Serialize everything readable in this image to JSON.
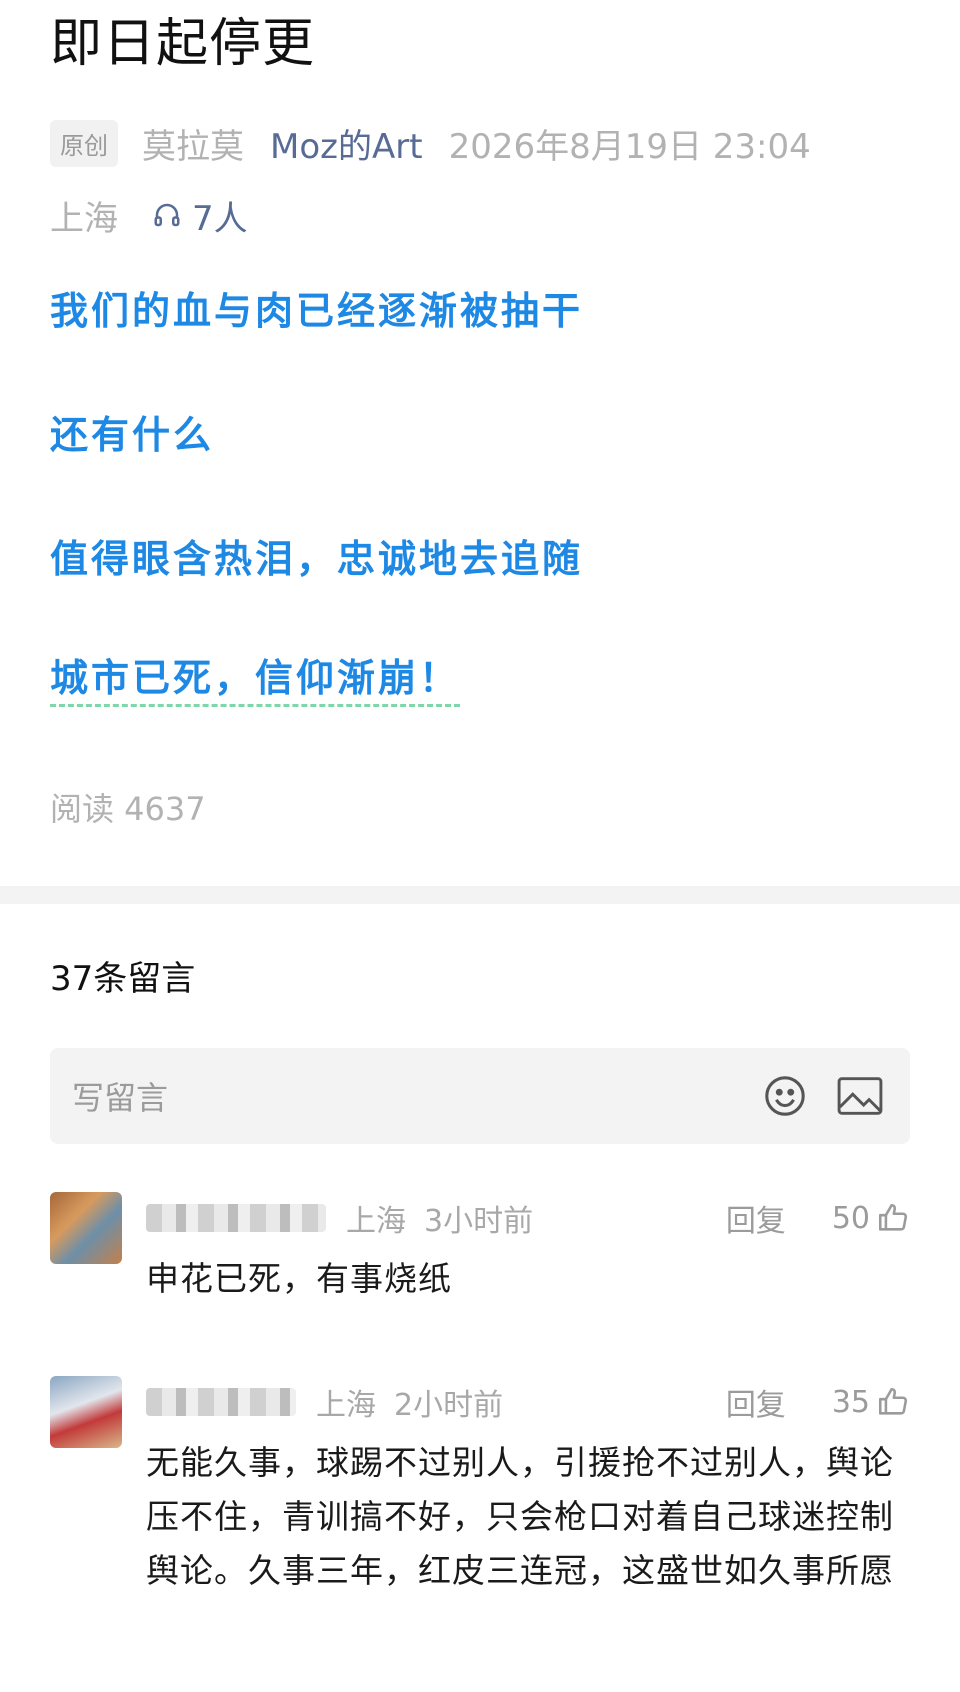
{
  "article": {
    "title": "即日起停更",
    "badge": "原创",
    "author": "莫拉莫",
    "account": "Moz的Art",
    "datetime": "2026年8月19日 23:04",
    "location": "上海",
    "listeners": "7人",
    "lines": [
      "我们的血与肉已经逐渐被抽干",
      "还有什么",
      "值得眼含热泪，忠诚地去追随",
      "城市已死，信仰渐崩！"
    ],
    "reads": "阅读 4637"
  },
  "comments_section": {
    "count_label": "37条留言",
    "write_placeholder": "写留言",
    "icons": [
      "emoji-icon",
      "image-icon"
    ],
    "items": [
      {
        "location": "上海",
        "time": "3小时前",
        "reply_label": "回复",
        "likes": "50",
        "text": "申花已死，有事烧纸"
      },
      {
        "location": "上海",
        "time": "2小时前",
        "reply_label": "回复",
        "likes": "35",
        "text": "无能久事，球踢不过别人，引援抢不过别人，舆论压不住，青训搞不好，只会枪口对着自己球迷控制舆论。久事三年，红皮三连冠，这盛世如久事所愿"
      }
    ]
  },
  "colors": {
    "accent_blue": "#1e88e5",
    "link": "#576b95",
    "muted": "#b2b2b2"
  }
}
